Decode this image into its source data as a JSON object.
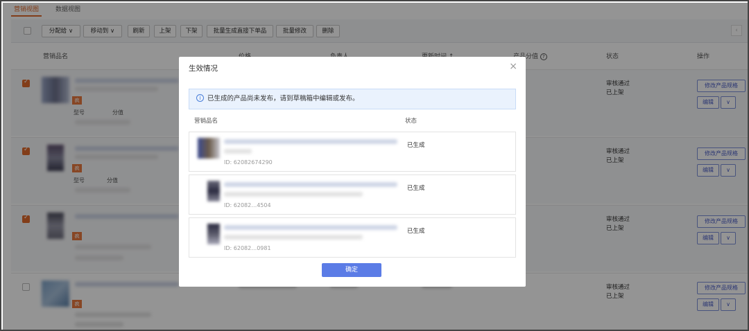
{
  "tabs": [
    {
      "label": "营销视图",
      "active": true
    },
    {
      "label": "数据视图",
      "active": false
    }
  ],
  "toolbar": {
    "buttons": [
      "分配给",
      "移动到",
      "刷新",
      "上架",
      "下架",
      "批量生成直接下单品",
      "批量修改",
      "删除"
    ],
    "dropdown_arrow": "∨"
  },
  "table": {
    "headers": [
      "营销品名",
      "价格",
      "负责人",
      "更新时间 ↕",
      "产品分值",
      "状态",
      "操作"
    ],
    "help_icon": "?",
    "rows": [
      {
        "checked": true,
        "badge": "疯",
        "model_label": "型号",
        "score_label": "分值",
        "status_line1": "审核通过",
        "status_line2": "已上架",
        "edit_product_btn": "修改产品规格",
        "edit_btn": "编辑",
        "more_arrow": "∨"
      },
      {
        "checked": true,
        "badge": "疯",
        "model_label": "型号",
        "score_label": "分值",
        "status_line1": "审核通过",
        "status_line2": "已上架",
        "edit_product_btn": "修改产品规格",
        "edit_btn": "编辑",
        "more_arrow": "∨"
      },
      {
        "checked": true,
        "badge": "疯",
        "model_label": "",
        "score_label": "",
        "status_line1": "审核通过",
        "status_line2": "已上架",
        "edit_product_btn": "修改产品规格",
        "edit_btn": "编辑",
        "more_arrow": "∨"
      },
      {
        "checked": false,
        "badge": "疯",
        "model_label": "",
        "score_label": "",
        "status_line1": "审核通过",
        "status_line2": "已上架",
        "edit_product_btn": "修改产品规格",
        "edit_btn": "编辑",
        "more_arrow": "∨"
      }
    ]
  },
  "modal": {
    "title": "生效情况",
    "close": "×",
    "alert_icon": "i",
    "alert_text": "已生成的产品尚未发布，请到草稿箱中编辑或发布。",
    "col_name": "营销品名",
    "col_status": "状态",
    "rows": [
      {
        "id": "ID: 62082674290",
        "status": "已生成"
      },
      {
        "id": "ID: 62082…4504",
        "status": "已生成"
      },
      {
        "id": "ID: 62082…0981",
        "status": "已生成"
      }
    ],
    "ok": "确定"
  },
  "colors": {
    "accent": "#e06a2b",
    "primary": "#5b7ce6"
  }
}
